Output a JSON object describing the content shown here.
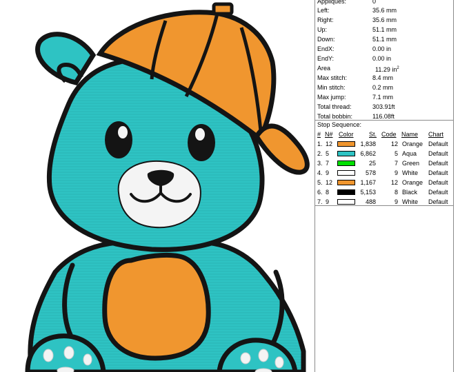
{
  "design_info": {
    "stats": [
      {
        "label": "Appliques:",
        "value": "0"
      },
      {
        "label": "Left:",
        "value": "35.6 mm"
      },
      {
        "label": "Right:",
        "value": "35.6 mm"
      },
      {
        "label": "Up:",
        "value": "51.1 mm"
      },
      {
        "label": "Down:",
        "value": "51.1 mm"
      },
      {
        "label": "EndX:",
        "value": "0.00 in"
      },
      {
        "label": "EndY:",
        "value": "0.00 in"
      },
      {
        "label": "Area",
        "value": "11.29 in",
        "unit_sup": "2"
      },
      {
        "label": "Max stitch:",
        "value": "8.4 mm"
      },
      {
        "label": "Min stitch:",
        "value": "0.2 mm"
      },
      {
        "label": "Max jump:",
        "value": "7.1 mm"
      },
      {
        "label": "Total thread:",
        "value": "303.91ft"
      },
      {
        "label": "Total bobbin:",
        "value": "116.08ft"
      }
    ]
  },
  "stop_sequence": {
    "title": "Stop Sequence:",
    "headers": {
      "index": "#",
      "needle": "N#",
      "color": "Color",
      "stitches": "St.",
      "code": "Code",
      "name": "Name",
      "chart": "Chart"
    },
    "rows": [
      {
        "index": "1.",
        "needle": "12",
        "color": "#f0962f",
        "stitches": "1,838",
        "code": "12",
        "name": "Orange",
        "chart": "Default"
      },
      {
        "index": "2.",
        "needle": "5",
        "color": "#2ec3c3",
        "stitches": "6,862",
        "code": "5",
        "name": "Aqua",
        "chart": "Default"
      },
      {
        "index": "3.",
        "needle": "7",
        "color": "#00e000",
        "stitches": "25",
        "code": "7",
        "name": "Green",
        "chart": "Default"
      },
      {
        "index": "4.",
        "needle": "9",
        "color": "#ffffff",
        "stitches": "578",
        "code": "9",
        "name": "White",
        "chart": "Default"
      },
      {
        "index": "5.",
        "needle": "12",
        "color": "#f0962f",
        "stitches": "1,167",
        "code": "12",
        "name": "Orange",
        "chart": "Default"
      },
      {
        "index": "6.",
        "needle": "8",
        "color": "#000000",
        "stitches": "5,153",
        "code": "8",
        "name": "Black",
        "chart": "Default"
      },
      {
        "index": "7.",
        "needle": "9",
        "color": "#ffffff",
        "stitches": "488",
        "code": "9",
        "name": "White",
        "chart": "Default"
      }
    ]
  },
  "colors": {
    "aqua": "#2ec3c3",
    "orange": "#f0962f",
    "black": "#141414",
    "white": "#f4f4f4"
  }
}
